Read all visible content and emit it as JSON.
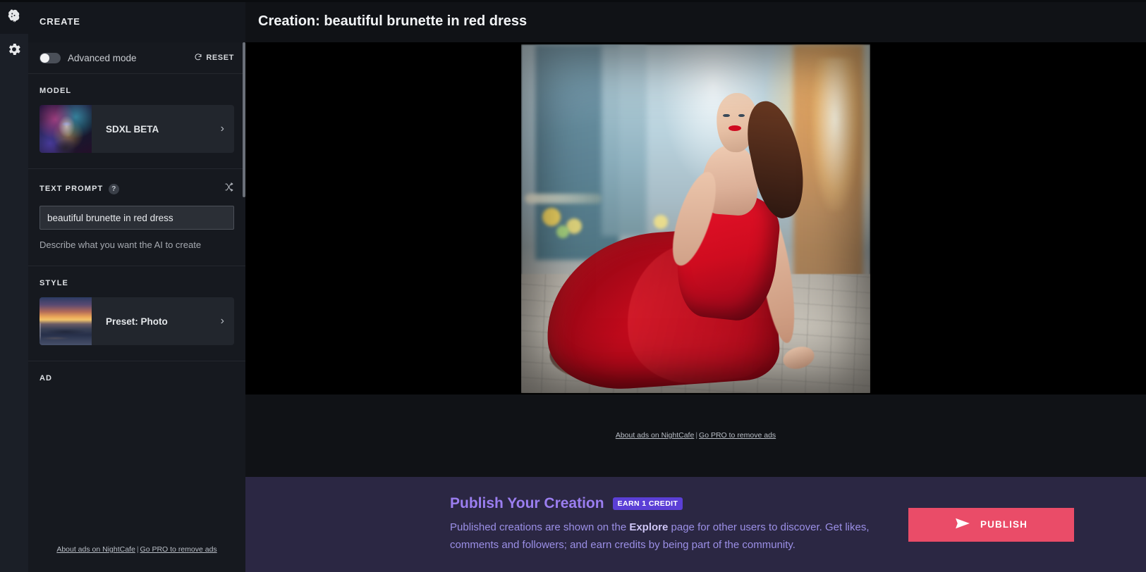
{
  "rail": {
    "items": [
      {
        "name": "create",
        "icon": "brain-icon",
        "active": true
      },
      {
        "name": "settings",
        "icon": "gear-icon",
        "active": false
      }
    ]
  },
  "sidebar": {
    "title": "CREATE",
    "advanced_mode": {
      "label": "Advanced mode",
      "enabled": false
    },
    "reset_label": "RESET",
    "model": {
      "section_label": "MODEL",
      "selected": "SDXL BETA",
      "chevron": "›"
    },
    "text_prompt": {
      "section_label": "TEXT PROMPT",
      "help_glyph": "?",
      "value": "beautiful brunette in red dress",
      "placeholder": "Describe what you want the AI to create",
      "hint": "Describe what you want the AI to create"
    },
    "style": {
      "section_label": "STYLE",
      "selected": "Preset: Photo",
      "chevron": "›"
    },
    "ad": {
      "label": "AD",
      "link_about": "About ads on NightCafe",
      "separator": "|",
      "link_pro": "Go PRO to remove ads"
    }
  },
  "main": {
    "title": "Creation: beautiful brunette in red dress",
    "image_alt": "beautiful brunette in red dress",
    "ad_links": {
      "link_about": "About ads on NightCafe",
      "separator": "|",
      "link_pro": "Go PRO to remove ads"
    }
  },
  "publish": {
    "title": "Publish Your Creation",
    "badge": "EARN 1 CREDIT",
    "description_part1": "Published creations are shown on the ",
    "description_emphasis": "Explore",
    "description_part2": " page for other users to discover. Get likes, comments and followers; and earn credits by being part of the community.",
    "button_label": "PUBLISH"
  },
  "colors": {
    "accent_publish": "#ea4c68",
    "accent_purple": "#9b7ef0",
    "badge_purple": "#5b3fd6",
    "banner_bg": "#2b2743",
    "sidebar_bg": "#16191f",
    "rail_bg": "#1b1f27",
    "canvas_bg": "#000000"
  }
}
